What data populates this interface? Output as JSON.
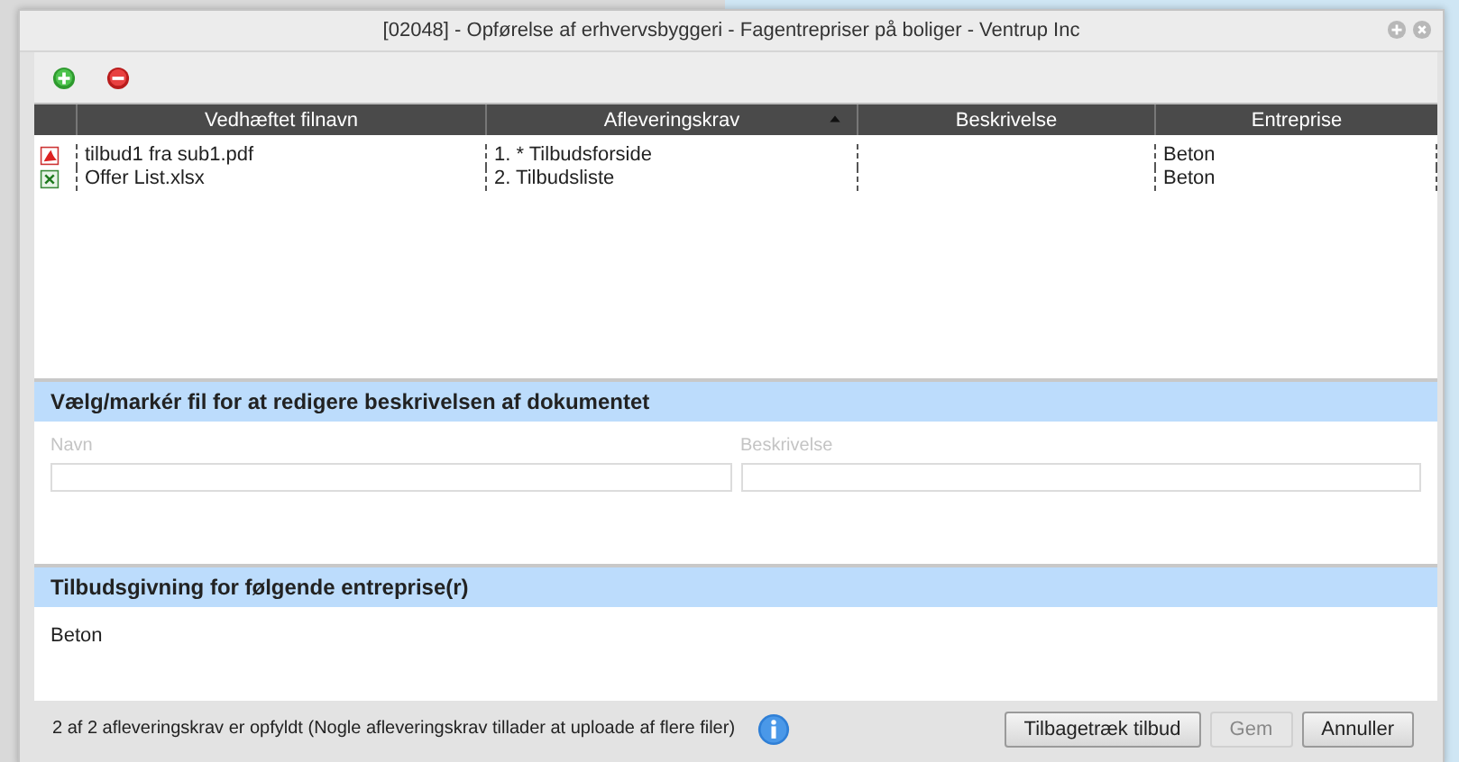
{
  "window": {
    "title": "[02048] - Opførelse af erhvervsbyggeri - Fagentrepriser på boliger - Ventrup Inc"
  },
  "toolbar": [
    {
      "kind": "add"
    },
    {
      "kind": "remove"
    }
  ],
  "table": {
    "columns": [
      {
        "label": "Vedhæftet filnavn",
        "sorted": false
      },
      {
        "label": "Afleveringskrav",
        "sorted": true
      },
      {
        "label": "Beskrivelse",
        "sorted": false
      },
      {
        "label": "Entreprise",
        "sorted": false
      }
    ],
    "rows": [
      {
        "kind": "pdf",
        "cells": [
          "tilbud1 fra sub1.pdf",
          "1. * Tilbudsforside",
          "",
          "Beton"
        ]
      },
      {
        "kind": "excel",
        "cells": [
          "Offer List.xlsx",
          "2. Tilbudsliste",
          "",
          "Beton"
        ]
      }
    ]
  },
  "edit_section": {
    "title": "Vælg/markér fil for at redigere beskrivelsen af dokumentet",
    "fields": [
      {
        "label": "Navn",
        "disabled": true
      },
      {
        "label": "Beskrivelse",
        "disabled": true
      }
    ]
  },
  "trades_section": {
    "title": "Tilbudsgivning for følgende entreprise(r)",
    "items": [
      "Beton"
    ]
  },
  "status": "2 af 2 afleveringskrav er opfyldt (Nogle afleveringskrav tillader at uploade af flere filer)",
  "buttons": [
    {
      "label": "Tilbagetræk tilbud",
      "disabled": false
    },
    {
      "label": "Gem",
      "disabled": true
    },
    {
      "label": "Annuller",
      "disabled": false
    }
  ]
}
